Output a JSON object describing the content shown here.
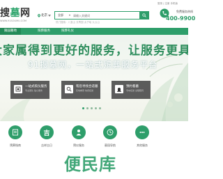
{
  "header": {
    "logo_main_prefix": "搜",
    "logo_main_accent": "墓",
    "logo_main_suffix": "网",
    "logo_sub": "WWW.91SOUMU.COM",
    "city": "北京",
    "search_type": "全部",
    "search_placeholder": "请输入关键词",
    "hot_words": "热门搜索：八宝山  长青园  太子峪  九公山",
    "user_links": "登录 | 注册  手机版",
    "hotline_label": "免费服务热线",
    "hotline_number": "400-9900"
  },
  "nav": {
    "items": [
      "陵园墓地",
      "殡葬服务",
      "殡葬礼仪"
    ]
  },
  "banner": {
    "headline": "大家属得到更好的服务，让服务更具价值",
    "subline": "91搜墓网，一站式殡葬服务平台",
    "cards": [
      {
        "title": "一站式殡仪服务",
        "sub": "专业团队 贴心服务"
      },
      {
        "title": "帮您寻找合适墓",
        "sub": "实地看墓 免费接送"
      },
      {
        "title": "预约看墓",
        "sub": "专车接送 全程陪同"
      }
    ]
  },
  "services": {
    "items": [
      {
        "label": "殡葬指南",
        "icon": "book-icon"
      },
      {
        "label": "吉祥吉日",
        "icon": "ji-icon"
      },
      {
        "label": "殡仪服务",
        "icon": "person-icon"
      },
      {
        "label": "墓园导航",
        "icon": "clock-icon"
      },
      {
        "label": "其他服务",
        "icon": "more-icon"
      }
    ]
  },
  "watermark": "便民库",
  "colors": {
    "brand_green": "#2e9e6a",
    "nav_active": "#238a58",
    "card_bg": "#464646"
  }
}
